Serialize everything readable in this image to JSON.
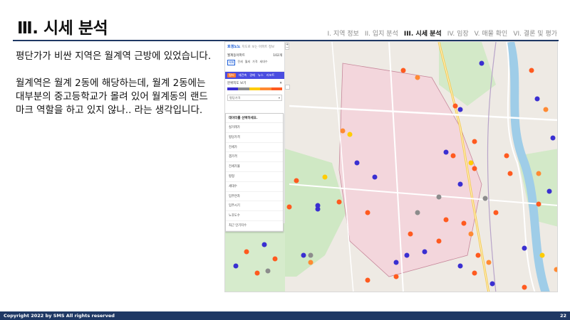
{
  "header": {
    "title": "Ⅲ. 시세 분석",
    "nav": [
      {
        "label": "I. 지역 정보",
        "active": false
      },
      {
        "label": "II. 입지 분석",
        "active": false
      },
      {
        "label": "III. 시세 분석",
        "active": true
      },
      {
        "label": "IV. 임장",
        "active": false
      },
      {
        "label": "V. 매물 확인",
        "active": false
      },
      {
        "label": "VI. 결론 및 평가",
        "active": false
      }
    ]
  },
  "body": {
    "paragraph1": "평단가가 비싼 지역은 월계역 근방에 있었습니다.",
    "paragraph2": "월계역은 월계 2동에 해당하는데, 월계 2동에는 대부분의 중고등학교가 몰려 있어 월계동의 랜드마크 역할을 하고 있지 않나.. 라는 생각입니다."
  },
  "map": {
    "panel": {
      "logo": "호갱노노",
      "logo_sub": "지도로 보는 아파트 정보",
      "address": "월계동아파트",
      "address_count": "102개",
      "small_tabs": [
        "매매",
        "전세",
        "월세",
        "가격",
        "세대수"
      ],
      "blue_tabs": [
        "필터",
        "재건축",
        "경매",
        "뉴스",
        "리포트"
      ],
      "filter_label": "분위지도 보기",
      "select_label": "평당가격",
      "dropdown_header": "데이터를 선택하세요.",
      "dropdown_options": [
        "실거래가",
        "평당가격",
        "전세가",
        "갭가격",
        "전세가율",
        "평형",
        "세대수",
        "입주연차",
        "입주시기",
        "노후도수",
        "최근 인기지수"
      ]
    },
    "colors": {
      "high": "#ff5a1f",
      "mid": "#ff8a33",
      "low": "#3a2fd1",
      "yellow": "#ffcc00",
      "gray": "#8c8c8c"
    }
  },
  "footer": {
    "copyright": "Copyright 2022 by SMS All rights reserved",
    "page_number": "22"
  }
}
